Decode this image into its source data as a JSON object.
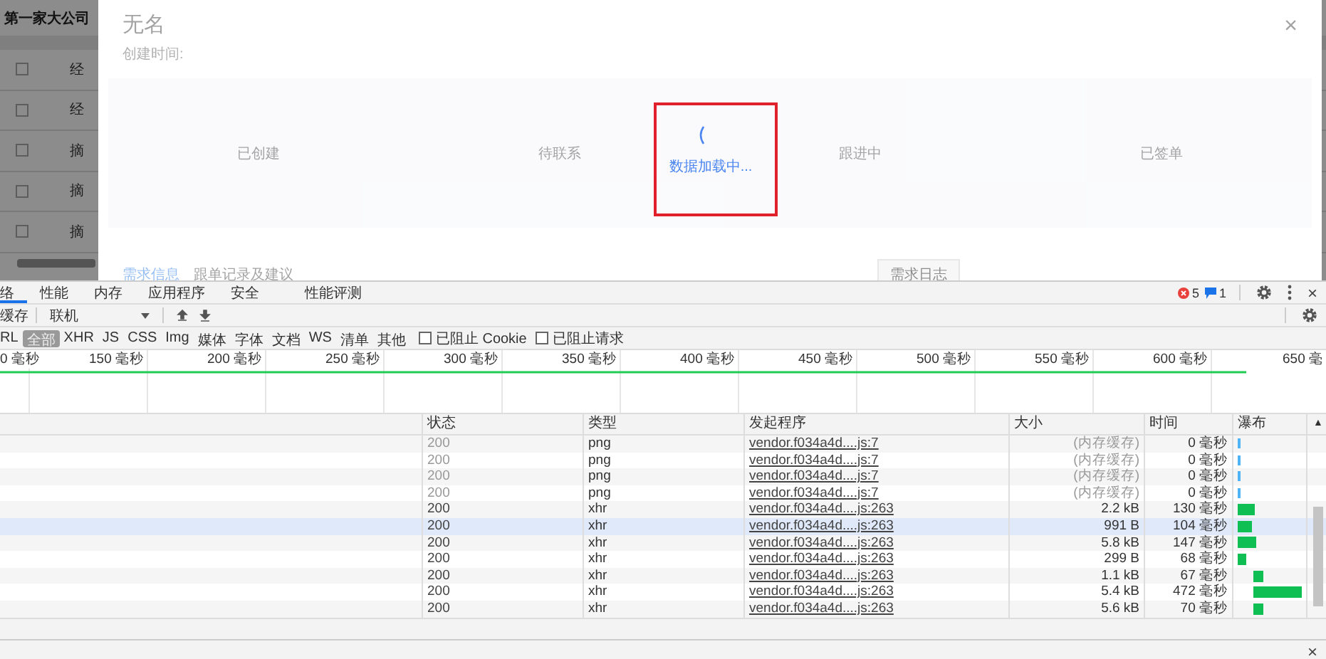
{
  "background_app": {
    "title": "第一家大公司",
    "rows": [
      {
        "text": "经",
        "checked": false
      },
      {
        "text": "经",
        "checked": false
      },
      {
        "text": "摘",
        "checked": false
      },
      {
        "text": "摘",
        "checked": false
      },
      {
        "text": "摘",
        "checked": false
      }
    ]
  },
  "drawer": {
    "title": "无名",
    "created_label": "创建时间:",
    "close": "×",
    "steps": [
      "已创建",
      "待联系",
      "跟进中",
      "已签单"
    ],
    "tabs": [
      {
        "label": "需求信息",
        "selected": true
      },
      {
        "label": "跟单记录及建议",
        "selected": false
      }
    ],
    "log_button": "需求日志",
    "loading_text": "数据加载中..."
  },
  "devtools": {
    "tabs": [
      {
        "label": "络",
        "selected": true
      },
      {
        "label": "性能",
        "selected": false
      },
      {
        "label": "内存",
        "selected": false
      },
      {
        "label": "应用程序",
        "selected": false
      },
      {
        "label": "安全",
        "selected": false
      },
      {
        "label": "性能评测",
        "selected": false
      }
    ],
    "errors": "5",
    "messages": "1",
    "close": "×",
    "toolbar": {
      "cache_label": "缓存",
      "throttle": "联机"
    },
    "filters": [
      {
        "label": "RL",
        "selected": false
      },
      {
        "label": "全部",
        "selected": true
      },
      {
        "label": "XHR",
        "selected": false
      },
      {
        "label": "JS",
        "selected": false
      },
      {
        "label": "CSS",
        "selected": false
      },
      {
        "label": "Img",
        "selected": false
      },
      {
        "label": "媒体",
        "selected": false
      },
      {
        "label": "字体",
        "selected": false
      },
      {
        "label": "文档",
        "selected": false
      },
      {
        "label": "WS",
        "selected": false
      },
      {
        "label": "清单",
        "selected": false
      },
      {
        "label": "其他",
        "selected": false
      }
    ],
    "checkboxes": [
      {
        "label": "已阻止 Cookie",
        "checked": false
      },
      {
        "label": "已阻止请求",
        "checked": false
      }
    ],
    "ticks": [
      "0 毫秒",
      "150 毫秒",
      "200 毫秒",
      "250 毫秒",
      "300 毫秒",
      "350 毫秒",
      "400 毫秒",
      "450 毫秒",
      "500 毫秒",
      "550 毫秒",
      "600 毫秒",
      "650 毫"
    ],
    "columns": [
      "状态",
      "类型",
      "发起程序",
      "大小",
      "时间",
      "瀑布"
    ],
    "sort_arrow": "▲",
    "rows": [
      {
        "status": "200",
        "type": "png",
        "initiator": "vendor.f034a4d....js:7",
        "size": "(内存缓存)",
        "time": "0 毫秒",
        "kind": "cached",
        "selected": false
      },
      {
        "status": "200",
        "type": "png",
        "initiator": "vendor.f034a4d....js:7",
        "size": "(内存缓存)",
        "time": "0 毫秒",
        "kind": "cached",
        "selected": false
      },
      {
        "status": "200",
        "type": "png",
        "initiator": "vendor.f034a4d....js:7",
        "size": "(内存缓存)",
        "time": "0 毫秒",
        "kind": "cached",
        "selected": false
      },
      {
        "status": "200",
        "type": "png",
        "initiator": "vendor.f034a4d....js:7",
        "size": "(内存缓存)",
        "time": "0 毫秒",
        "kind": "cached",
        "selected": false
      },
      {
        "status": "200",
        "type": "xhr",
        "initiator": "vendor.f034a4d....js:263",
        "size": "2.2 kB",
        "time": "130 毫秒",
        "kind": "network",
        "selected": false
      },
      {
        "status": "200",
        "type": "xhr",
        "initiator": "vendor.f034a4d....js:263",
        "size": "991 B",
        "time": "104 毫秒",
        "kind": "network",
        "selected": true
      },
      {
        "status": "200",
        "type": "xhr",
        "initiator": "vendor.f034a4d....js:263",
        "size": "5.8 kB",
        "time": "147 毫秒",
        "kind": "network",
        "selected": false
      },
      {
        "status": "200",
        "type": "xhr",
        "initiator": "vendor.f034a4d....js:263",
        "size": "299 B",
        "time": "68 毫秒",
        "kind": "network",
        "selected": false
      },
      {
        "status": "200",
        "type": "xhr",
        "initiator": "vendor.f034a4d....js:263",
        "size": "1.1 kB",
        "time": "67 毫秒",
        "kind": "network",
        "selected": false
      },
      {
        "status": "200",
        "type": "xhr",
        "initiator": "vendor.f034a4d....js:263",
        "size": "5.4 kB",
        "time": "472 毫秒",
        "kind": "network",
        "selected": false
      },
      {
        "status": "200",
        "type": "xhr",
        "initiator": "vendor.f034a4d....js:263",
        "size": "5.6 kB",
        "time": "70 毫秒",
        "kind": "network",
        "selected": false
      }
    ],
    "drawer_close": "×"
  }
}
